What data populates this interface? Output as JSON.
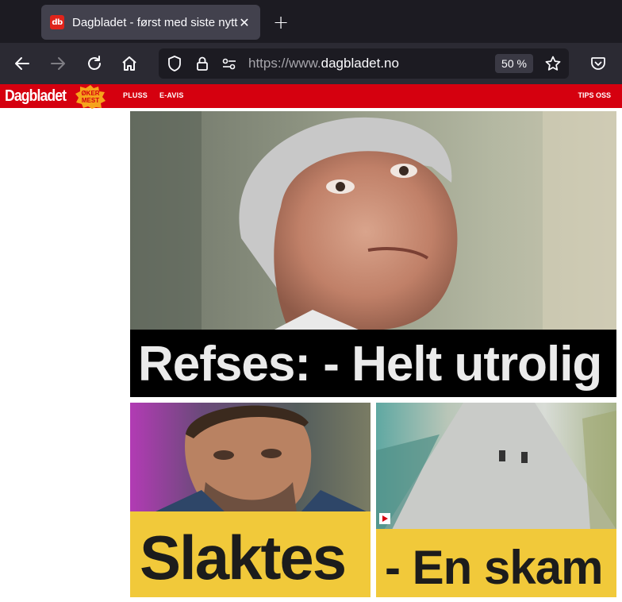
{
  "browser": {
    "tab": {
      "favicon_text": "db",
      "title": "Dagbladet - først med siste nytt"
    },
    "url": {
      "prefix": "https://www.",
      "domain": "dagbladet.no"
    },
    "zoom": "50 %"
  },
  "site": {
    "logo": "Dagbladet",
    "badge": [
      "ØKER",
      "MEST"
    ],
    "nav": {
      "pluss": "PLUSS",
      "eavis": "E-AVIS",
      "tips": "TIPS OSS"
    },
    "colors": {
      "brand_red": "#d5000f",
      "headline_yellow": "#f1c93a"
    }
  },
  "articles": {
    "hero": {
      "headline": "Refses: - Helt utrolig"
    },
    "left": {
      "headline": "Slaktes"
    },
    "right": {
      "headline": "- En skam"
    }
  }
}
